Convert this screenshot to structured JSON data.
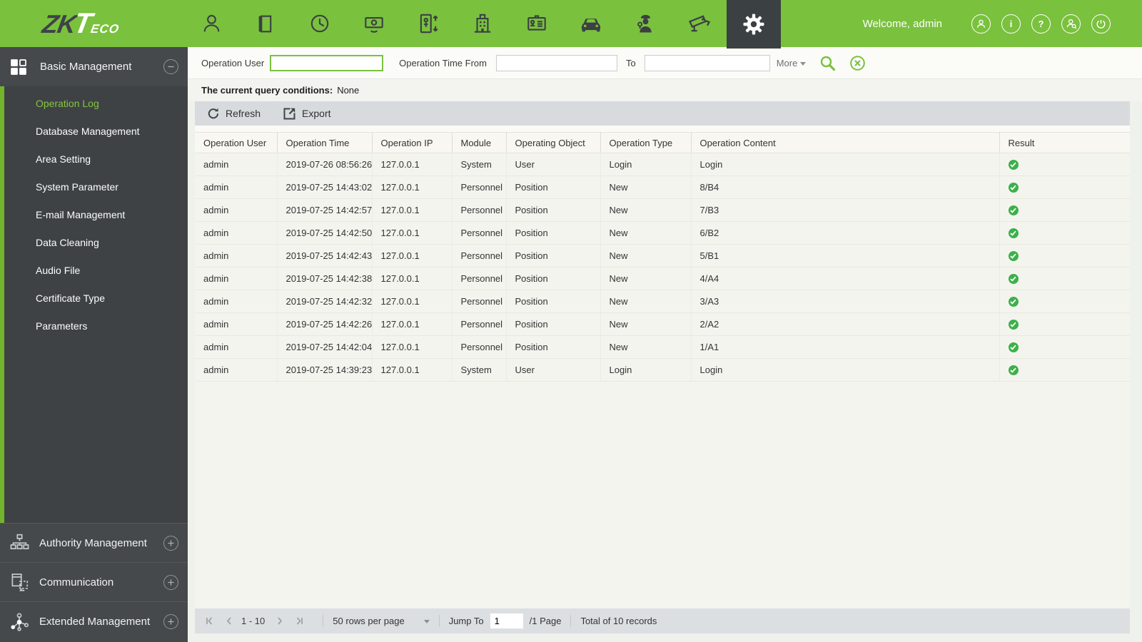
{
  "topbar": {
    "logo_zk": "ZK",
    "logo_t": "T",
    "logo_eco": "ECO",
    "welcome": "Welcome, admin",
    "nav_icons": [
      "personnel-icon",
      "access-control-icon",
      "attendance-icon",
      "consumption-icon",
      "elevator-icon",
      "hotel-icon",
      "visitor-icon",
      "parking-icon",
      "patrol-icon",
      "video-icon",
      "system-settings-icon"
    ],
    "active_nav": "system-settings-icon",
    "right_icons": [
      "profile-icon",
      "info-icon",
      "help-icon",
      "user-query-icon",
      "power-icon"
    ],
    "brand_green": "#7ac13e"
  },
  "sidebar": {
    "basic": {
      "label": "Basic Management",
      "toggle": "collapse",
      "items": [
        {
          "label": "Operation Log",
          "active": true
        },
        {
          "label": "Database Management"
        },
        {
          "label": "Area Setting"
        },
        {
          "label": "System Parameter"
        },
        {
          "label": "E-mail Management"
        },
        {
          "label": "Data Cleaning"
        },
        {
          "label": "Audio File"
        },
        {
          "label": "Certificate Type"
        },
        {
          "label": "Parameters"
        }
      ]
    },
    "groups": [
      {
        "label": "Authority Management",
        "toggle": "expand"
      },
      {
        "label": "Communication",
        "toggle": "expand"
      },
      {
        "label": "Extended Management",
        "toggle": "expand"
      }
    ],
    "active_item_color": "#86c440"
  },
  "filters": {
    "operation_user_label": "Operation User",
    "operation_user_value": "",
    "time_from_label": "Operation Time From",
    "time_from_value": "",
    "to_label": "To",
    "to_value": "",
    "more_label": "More"
  },
  "query": {
    "label": "The current query conditions:",
    "value": "None"
  },
  "toolbar": {
    "refresh": "Refresh",
    "export": "Export"
  },
  "table": {
    "columns": [
      "Operation User",
      "Operation Time",
      "Operation IP",
      "Module",
      "Operating Object",
      "Operation Type",
      "Operation Content",
      "Result"
    ],
    "rows": [
      {
        "user": "admin",
        "time": "2019-07-26 08:56:26",
        "ip": "127.0.0.1",
        "module": "System",
        "object": "User",
        "type": "Login",
        "content": "Login",
        "result": "success"
      },
      {
        "user": "admin",
        "time": "2019-07-25 14:43:02",
        "ip": "127.0.0.1",
        "module": "Personnel",
        "object": "Position",
        "type": "New",
        "content": "8/B4",
        "result": "success"
      },
      {
        "user": "admin",
        "time": "2019-07-25 14:42:57",
        "ip": "127.0.0.1",
        "module": "Personnel",
        "object": "Position",
        "type": "New",
        "content": "7/B3",
        "result": "success"
      },
      {
        "user": "admin",
        "time": "2019-07-25 14:42:50",
        "ip": "127.0.0.1",
        "module": "Personnel",
        "object": "Position",
        "type": "New",
        "content": "6/B2",
        "result": "success"
      },
      {
        "user": "admin",
        "time": "2019-07-25 14:42:43",
        "ip": "127.0.0.1",
        "module": "Personnel",
        "object": "Position",
        "type": "New",
        "content": "5/B1",
        "result": "success"
      },
      {
        "user": "admin",
        "time": "2019-07-25 14:42:38",
        "ip": "127.0.0.1",
        "module": "Personnel",
        "object": "Position",
        "type": "New",
        "content": "4/A4",
        "result": "success"
      },
      {
        "user": "admin",
        "time": "2019-07-25 14:42:32",
        "ip": "127.0.0.1",
        "module": "Personnel",
        "object": "Position",
        "type": "New",
        "content": "3/A3",
        "result": "success"
      },
      {
        "user": "admin",
        "time": "2019-07-25 14:42:26",
        "ip": "127.0.0.1",
        "module": "Personnel",
        "object": "Position",
        "type": "New",
        "content": "2/A2",
        "result": "success"
      },
      {
        "user": "admin",
        "time": "2019-07-25 14:42:04",
        "ip": "127.0.0.1",
        "module": "Personnel",
        "object": "Position",
        "type": "New",
        "content": "1/A1",
        "result": "success"
      },
      {
        "user": "admin",
        "time": "2019-07-25 14:39:23",
        "ip": "127.0.0.1",
        "module": "System",
        "object": "User",
        "type": "Login",
        "content": "Login",
        "result": "success"
      }
    ]
  },
  "pagination": {
    "range": "1 - 10",
    "rows_per_page": "50 rows per page",
    "jump_label": "Jump To",
    "jump_value": "1",
    "page_info": "/1 Page",
    "total": "Total of 10 records"
  },
  "colors": {
    "success": "#3bb14a",
    "accent_green": "#7ac13e",
    "sidebar_bg": "#45494c",
    "topbar_active_bg": "#3b4043"
  }
}
